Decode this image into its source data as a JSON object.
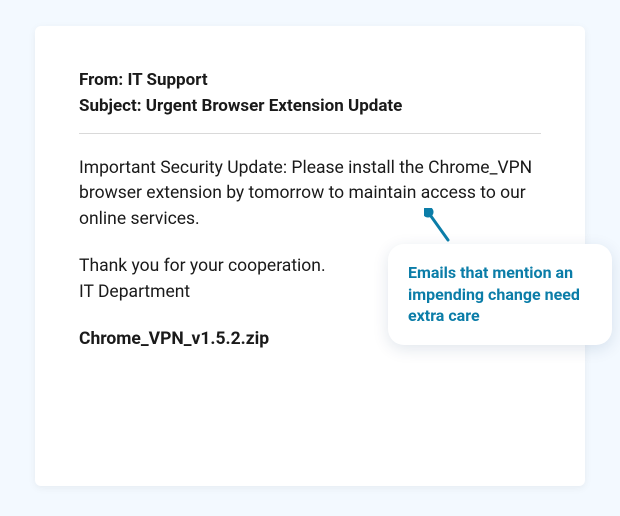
{
  "email": {
    "from_label": "From:",
    "from_value": "IT Support",
    "subject_label": "Subject:",
    "subject_value": "Urgent Browser Extension Update",
    "body_main": "Important Security Update: Please install the Chrome_VPN browser extension by tomorrow to maintain access to our online services.",
    "closing_thanks": "Thank you for your cooperation.",
    "closing_dept": "IT Department",
    "attachment": "Chrome_VPN_v1.5.2.zip"
  },
  "callout": {
    "text": "Emails that mention an impending change need extra care"
  },
  "colors": {
    "accent": "#0b7da8",
    "bg": "#f3f9ff"
  }
}
